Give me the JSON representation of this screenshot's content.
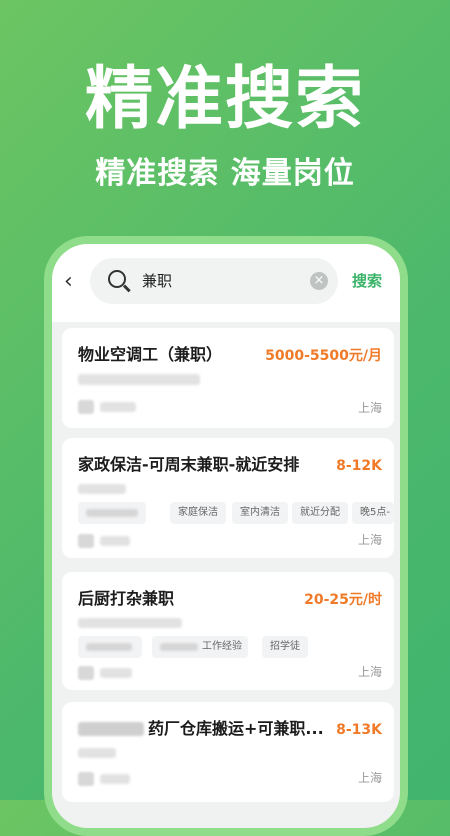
{
  "hero": {
    "title": "精准搜索",
    "subtitle": "精准搜索 海量岗位"
  },
  "search": {
    "back_icon": "‹",
    "query": "兼职",
    "clear_icon": "×",
    "button_label": "搜索"
  },
  "jobs": [
    {
      "title": "物业空调工（兼职）",
      "salary": "5000-5500元/月",
      "location": "上海",
      "tags": []
    },
    {
      "title": "家政保洁-可周末兼职-就近安排",
      "salary": "8-12K",
      "location": "上海",
      "tags": [
        "家庭保洁",
        "室内清洁",
        "就近分配",
        "晚5点-"
      ]
    },
    {
      "title": "后厨打杂兼职",
      "salary": "20-25元/时",
      "location": "上海",
      "tags": [
        "工作经验",
        "招学徒"
      ]
    },
    {
      "title": "药厂仓库搬运+可兼职...",
      "salary": "8-13K",
      "location": "上海",
      "tags": []
    }
  ],
  "colors": {
    "accent_green": "#3bb46a",
    "salary_orange": "#f07a27",
    "background_green": "#4cb86c"
  }
}
